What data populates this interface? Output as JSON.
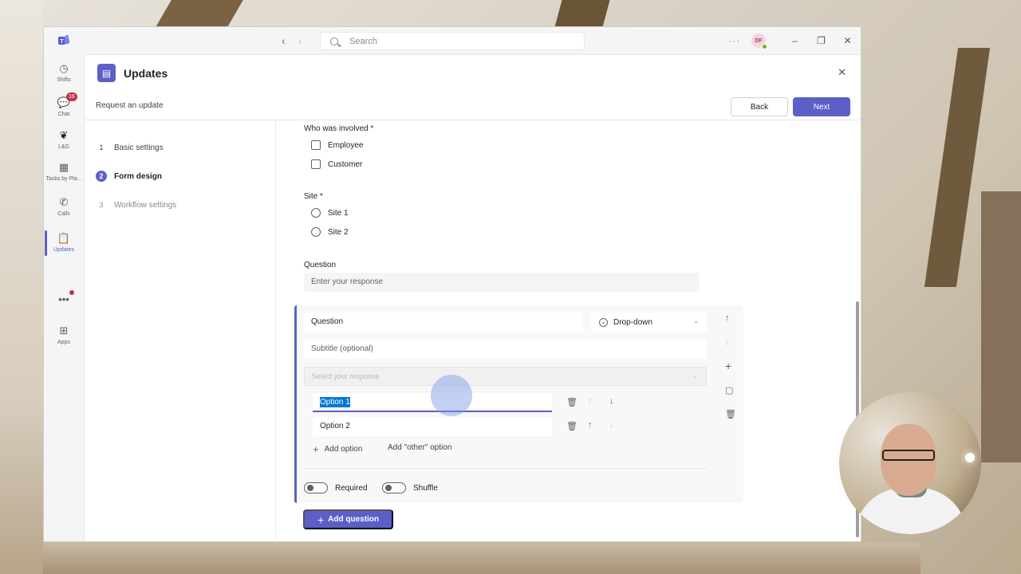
{
  "window": {
    "search_placeholder": "Search",
    "more_label": "···",
    "avatar_initials": "DF"
  },
  "rail": {
    "items": [
      {
        "label": "Shifts"
      },
      {
        "label": "Chat",
        "badge": "16"
      },
      {
        "label": "L&G"
      },
      {
        "label": "Tasks by Pla..."
      },
      {
        "label": "Calls"
      },
      {
        "label": "Updates"
      },
      {
        "label": "Apps"
      }
    ]
  },
  "app": {
    "title": "Updates",
    "breadcrumb": "Request an update",
    "back_label": "Back",
    "next_label": "Next"
  },
  "steps": [
    {
      "num": "1",
      "label": "Basic settings"
    },
    {
      "num": "2",
      "label": "Form design"
    },
    {
      "num": "3",
      "label": "Workflow settings"
    }
  ],
  "form": {
    "q1": {
      "label": "Who was involved",
      "required": "*",
      "options": [
        "Employee",
        "Customer"
      ]
    },
    "q2": {
      "label": "Site",
      "required": "*",
      "options": [
        "Site 1",
        "Site 2"
      ]
    },
    "q3": {
      "label": "Question",
      "response_placeholder": "Enter your response"
    },
    "editor": {
      "title_value": "Question",
      "type_label": "Drop-down",
      "subtitle_placeholder": "Subtitle (optional)",
      "select_placeholder": "Select your response",
      "options": [
        "Option 1",
        "Option 2"
      ],
      "add_option_label": "Add option",
      "add_other_label": "Add \"other\" option",
      "required_label": "Required",
      "shuffle_label": "Shuffle"
    },
    "add_question_label": "Add question"
  }
}
